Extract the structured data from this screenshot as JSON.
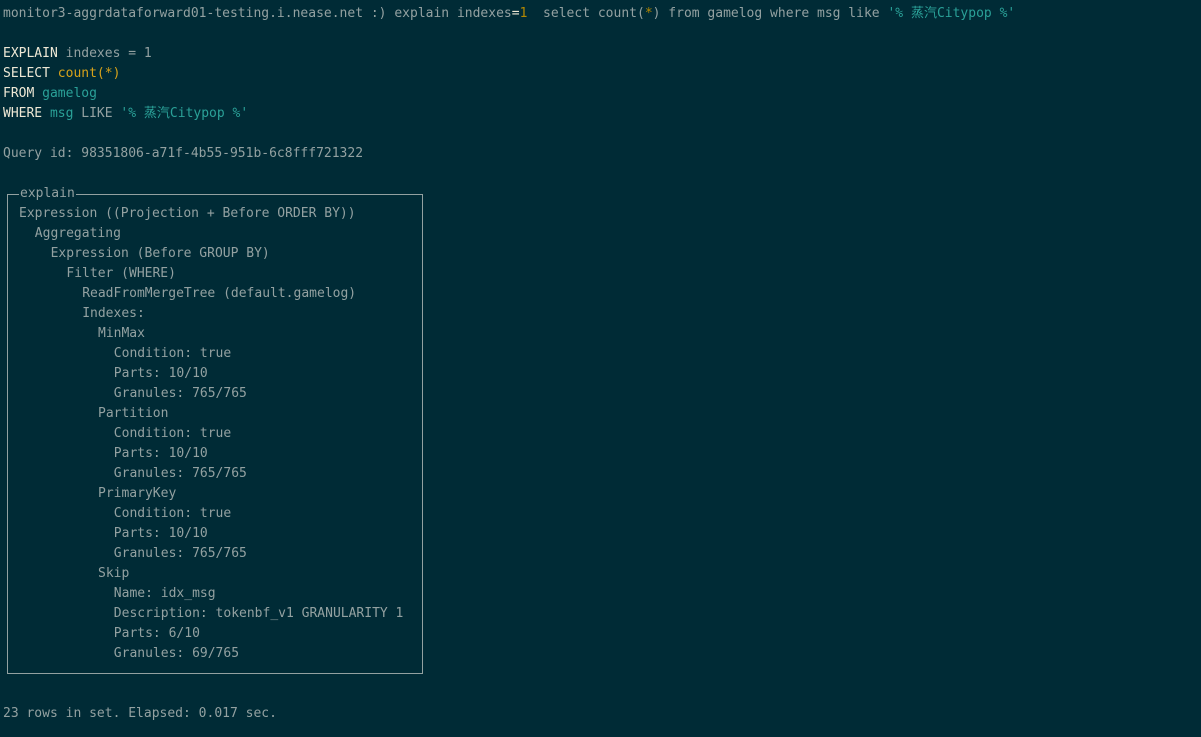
{
  "prompt": {
    "host": "monitor3-aggrdataforward01-testing.i.nease.net :) ",
    "cmd_a": "explain indexes",
    "eq": "=",
    "one": "1",
    "cmd_b": "  select count(",
    "star": "*",
    "cmd_c": ") from gamelog where msg like ",
    "str_a": "'% ",
    "str_cjk": "蒸汽",
    "str_b": "Citypop %'"
  },
  "formatted": {
    "l1_kw": "EXPLAIN",
    "l1_rest": " indexes = 1",
    "l2_kw": "SELECT",
    "l2_fn": "count(*)",
    "l3_kw": "FROM",
    "l3_id": "gamelog",
    "l4_kw": "WHERE",
    "l4_id": "msg",
    "l4_like": " LIKE ",
    "l4_str_a": "'% ",
    "l4_str_cjk": "蒸汽",
    "l4_str_b": "Citypop %'"
  },
  "query_id": "Query id: 98351806-a71f-4b55-951b-6c8fff721322",
  "explain": {
    "title": "explain",
    "rows": [
      {
        "indent": 0,
        "text": "Expression ((Projection + Before ORDER BY))"
      },
      {
        "indent": 1,
        "text": "Aggregating"
      },
      {
        "indent": 2,
        "text": "Expression (Before GROUP BY)"
      },
      {
        "indent": 3,
        "text": "Filter (WHERE)"
      },
      {
        "indent": 4,
        "text": "ReadFromMergeTree (default.gamelog)"
      },
      {
        "indent": 4,
        "text": "Indexes:"
      },
      {
        "indent": 5,
        "text": "MinMax"
      },
      {
        "indent": 6,
        "text": "Condition: true"
      },
      {
        "indent": 6,
        "text": "Parts: 10/10"
      },
      {
        "indent": 6,
        "text": "Granules: 765/765"
      },
      {
        "indent": 5,
        "text": "Partition"
      },
      {
        "indent": 6,
        "text": "Condition: true"
      },
      {
        "indent": 6,
        "text": "Parts: 10/10"
      },
      {
        "indent": 6,
        "text": "Granules: 765/765"
      },
      {
        "indent": 5,
        "text": "PrimaryKey"
      },
      {
        "indent": 6,
        "text": "Condition: true"
      },
      {
        "indent": 6,
        "text": "Parts: 10/10"
      },
      {
        "indent": 6,
        "text": "Granules: 765/765"
      },
      {
        "indent": 5,
        "text": "Skip"
      },
      {
        "indent": 6,
        "text": "Name: idx_msg"
      },
      {
        "indent": 6,
        "text": "Description: tokenbf_v1 GRANULARITY 1"
      },
      {
        "indent": 6,
        "text": "Parts: 6/10"
      },
      {
        "indent": 6,
        "text": "Granules: 69/765"
      }
    ]
  },
  "footer": "23 rows in set. Elapsed: 0.017 sec.",
  "colors": {
    "background": "#002b36",
    "text": "#93a1a1",
    "keyword": "#eee8d5",
    "function": "#d7a21a",
    "identifier": "#2aa198",
    "number": "#b58900"
  }
}
